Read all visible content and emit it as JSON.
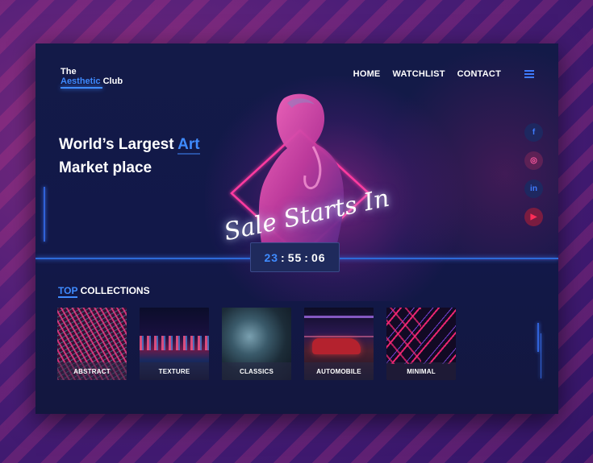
{
  "logo": {
    "line1": "The",
    "accent": "Aesthetic",
    "line2": "Club"
  },
  "nav": {
    "home": "HOME",
    "watchlist": "WATCHLIST",
    "contact": "CONTACT"
  },
  "hero": {
    "headline_prefix": "World’s Largest",
    "headline_accent": "Art",
    "headline_line2": "Market place",
    "sale_text": "Sale Starts In"
  },
  "countdown": {
    "hours": "23",
    "minutes": "55",
    "seconds": "06",
    "sep": ":"
  },
  "socials": {
    "facebook": "f",
    "instagram": "◎",
    "linkedin": "in",
    "youtube": "▶"
  },
  "collections": {
    "title_accent": "TOP",
    "title_rest": "COLLECTIONS",
    "items": [
      {
        "label": "ABSTRACT"
      },
      {
        "label": "TEXTURE"
      },
      {
        "label": "CLASSICS"
      },
      {
        "label": "AUTOMOBILE"
      },
      {
        "label": "MINIMAL"
      }
    ]
  },
  "colors": {
    "accent": "#3f8bff",
    "frame_bg": "#121849",
    "neon_pink": "#ff3aa0"
  }
}
